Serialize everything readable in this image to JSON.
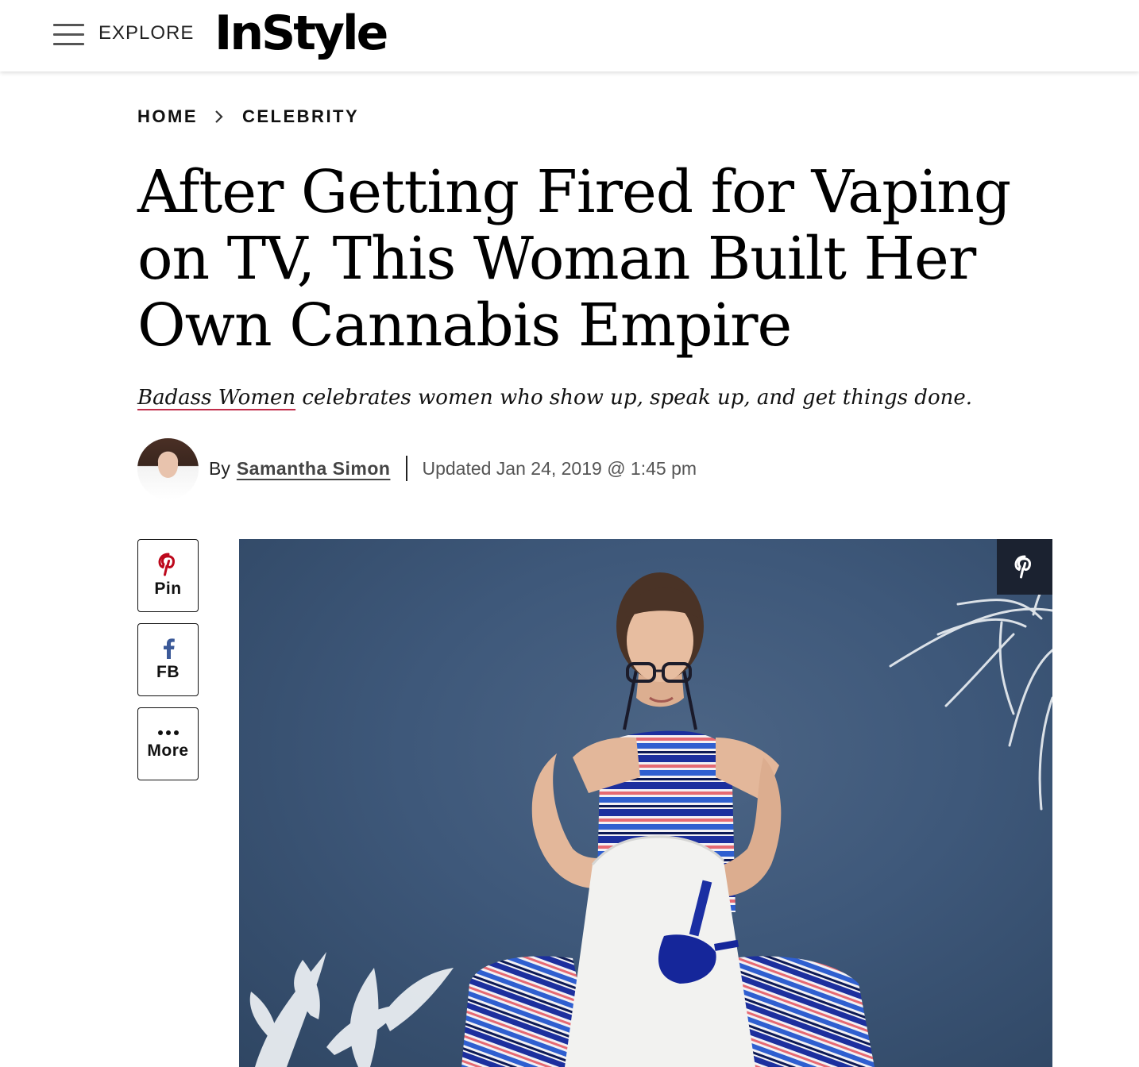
{
  "header": {
    "menu_label": "EXPLORE",
    "logo_text": "InStyle"
  },
  "breadcrumb": {
    "items": [
      "HOME",
      "CELEBRITY"
    ]
  },
  "article": {
    "title": "After Getting Fired for Vaping on TV, This Woman Built Her Own Cannabis Empire",
    "dek_link": "Badass Women",
    "dek_rest": " celebrates women who show up, speak up, and get things done.",
    "by_prefix": "By",
    "author": "Samantha Simon",
    "date": "Updated Jan 24, 2019 @ 1:45 pm"
  },
  "share": {
    "pin_label": "Pin",
    "fb_label": "FB",
    "more_label": "More"
  },
  "colors": {
    "pinterest_red": "#bd081c",
    "facebook_blue": "#3b5998",
    "dek_underline": "#c02d4a",
    "hero_background": "#3e587a",
    "pin_overlay": "#1b2230"
  },
  "icons": {
    "menu": "hamburger-icon",
    "breadcrumb_separator": "chevron-right-icon",
    "pinterest": "pinterest-icon",
    "facebook": "facebook-icon",
    "more": "ellipsis-icon"
  }
}
